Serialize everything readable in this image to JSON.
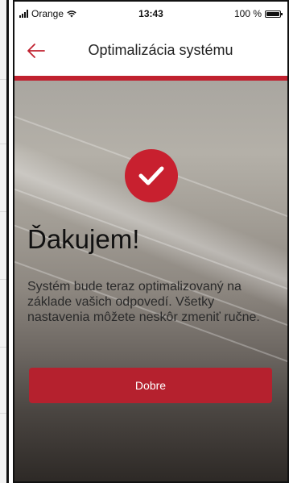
{
  "status_bar": {
    "carrier": "Orange",
    "time": "13:43",
    "battery": "100 %"
  },
  "header": {
    "title": "Optimalizácia systému",
    "back_icon": "arrow-left-icon",
    "accent_color": "#c0212f"
  },
  "main": {
    "icon": "checkmark-icon",
    "heading": "Ďakujem!",
    "message": "Systém bude teraz optimalizovaný na základe vašich odpovedí. Všetky nastavenia môžete neskôr zmeniť ručne.",
    "button_label": "Dobre",
    "button_color": "#b5212e"
  }
}
